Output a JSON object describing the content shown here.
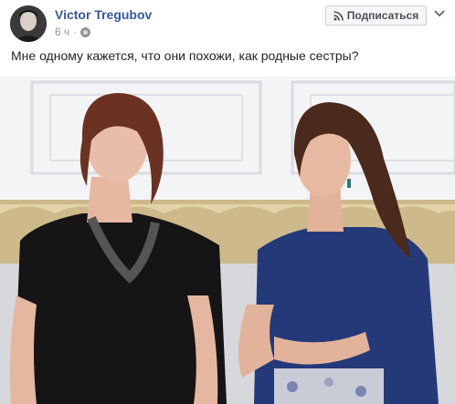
{
  "post": {
    "author": "Victor Tregubov",
    "time": "6 ч",
    "separator": "·",
    "subscribe_label": "Подписаться",
    "text": "Мне одному кажется, что они похожи, как родные сестры?"
  },
  "icons": {
    "avatar": "avatar",
    "privacy": "globe-icon",
    "subscribe": "rss-icon",
    "menu": "chevron-down-icon"
  },
  "colors": {
    "author_link": "#385898",
    "meta_text": "#90949c",
    "body_text": "#1d2129",
    "button_bg": "#f5f6f7"
  }
}
